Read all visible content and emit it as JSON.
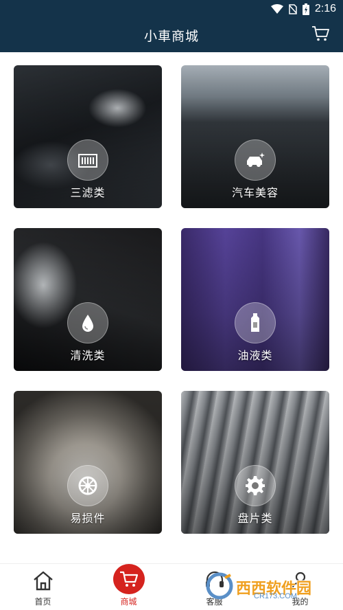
{
  "status_bar": {
    "time": "2:16",
    "icons": [
      "wifi-icon",
      "no-sim-icon",
      "battery-charging-icon"
    ]
  },
  "header": {
    "title": "小車商城",
    "cart_icon": "shopping-cart-icon"
  },
  "categories": [
    {
      "label": "三滤类",
      "icon": "filter-icon",
      "bg": "engine"
    },
    {
      "label": "汽车美容",
      "icon": "car-shine-icon",
      "bg": "beauty"
    },
    {
      "label": "清洗类",
      "icon": "water-drop-icon",
      "bg": "wash"
    },
    {
      "label": "油液类",
      "icon": "oil-bottle-icon",
      "bg": "oil"
    },
    {
      "label": "易损件",
      "icon": "wheel-icon",
      "bg": "wheel"
    },
    {
      "label": "盘片类",
      "icon": "gear-icon",
      "bg": "gear"
    }
  ],
  "bottom_nav": {
    "items": [
      {
        "label": "首页",
        "icon": "home-icon",
        "active": false
      },
      {
        "label": "商城",
        "icon": "shopping-cart-icon",
        "active": true
      },
      {
        "label": "客服",
        "icon": "headset-icon",
        "active": false
      },
      {
        "label": "我的",
        "icon": "user-icon",
        "active": false
      }
    ]
  },
  "watermark": {
    "text": "西西软件园",
    "sub": "CR173.COM"
  },
  "colors": {
    "header_bg": "#14334a",
    "accent_red": "#d5231e",
    "watermark_orange": "#f0a020"
  }
}
